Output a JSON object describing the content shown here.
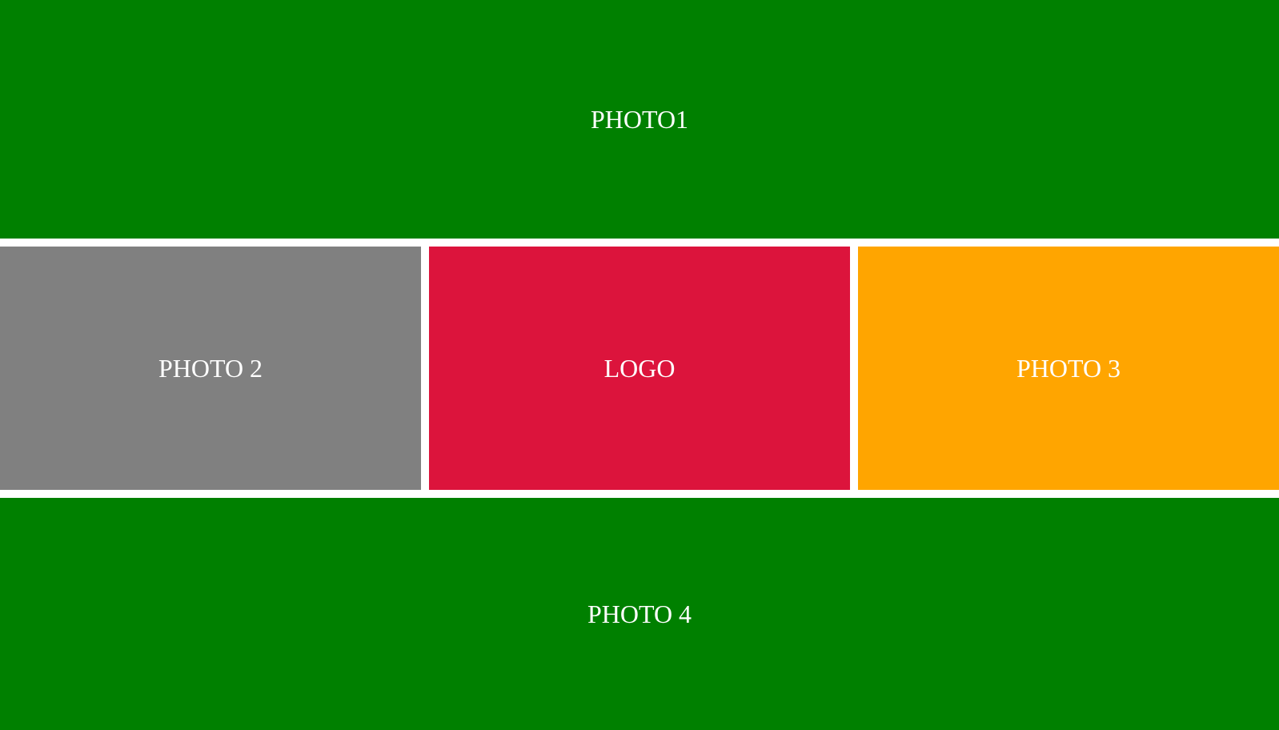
{
  "tiles": {
    "photo1": {
      "label": "PHOTO1",
      "color": "#008000"
    },
    "photo2": {
      "label": "PHOTO 2",
      "color": "#808080"
    },
    "logo": {
      "label": "LOGO",
      "color": "#DC143C"
    },
    "photo3": {
      "label": "PHOTO 3",
      "color": "#FFA500"
    },
    "photo4": {
      "label": "PHOTO 4",
      "color": "#008000"
    }
  }
}
